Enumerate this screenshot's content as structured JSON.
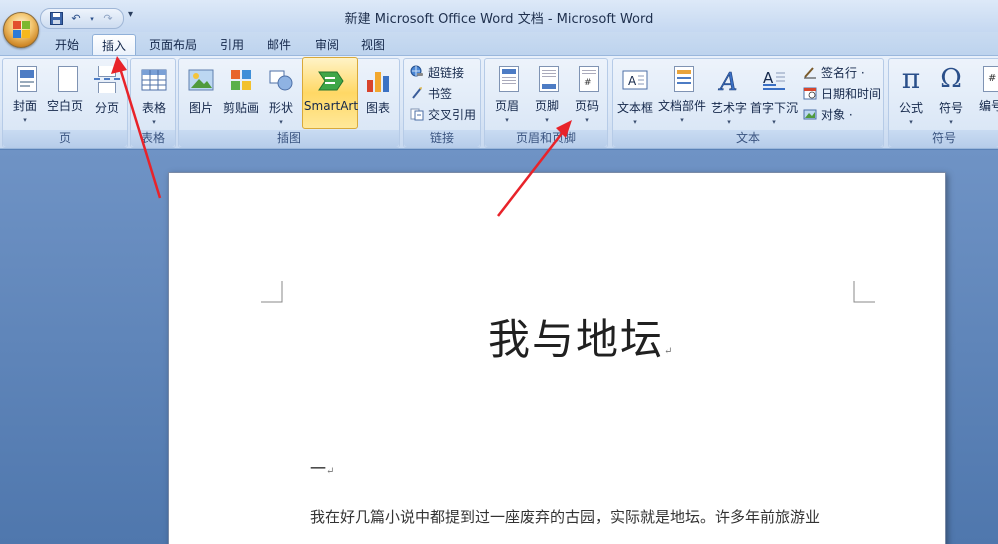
{
  "window": {
    "title": "新建 Microsoft Office Word 文档 - Microsoft Word"
  },
  "tabs": [
    {
      "label": "开始"
    },
    {
      "label": "插入",
      "active": true
    },
    {
      "label": "页面布局"
    },
    {
      "label": "引用"
    },
    {
      "label": "邮件"
    },
    {
      "label": "审阅"
    },
    {
      "label": "视图"
    }
  ],
  "groups": {
    "page": {
      "label": "页",
      "buttons": [
        "封面",
        "空白页",
        "分页"
      ]
    },
    "table": {
      "label": "表格",
      "buttons": [
        "表格"
      ]
    },
    "illustrations": {
      "label": "插图",
      "buttons": [
        "图片",
        "剪贴画",
        "形状",
        "SmartArt",
        "图表"
      ]
    },
    "links": {
      "label": "链接",
      "buttons": [
        "超链接",
        "书签",
        "交叉引用"
      ]
    },
    "header_footer": {
      "label": "页眉和页脚",
      "buttons": [
        "页眉",
        "页脚",
        "页码"
      ]
    },
    "text": {
      "label": "文本",
      "buttons": [
        "文本框",
        "文档部件",
        "艺术字",
        "首字下沉"
      ],
      "small": [
        "签名行 ·",
        "日期和时间",
        "对象 ·"
      ]
    },
    "symbols": {
      "label": "符号",
      "buttons": [
        "公式",
        "符号",
        "编号"
      ]
    }
  },
  "document": {
    "title": "我与地坛",
    "heading": "一",
    "paragraph": "我在好几篇小说中都提到过一座废弃的古园，实际就是地坛。许多年前旅游业"
  },
  "annotations": {
    "arrow_color": "#e8232a",
    "arrows": [
      "points-to-insert-tab",
      "points-to-page-number-button"
    ]
  }
}
